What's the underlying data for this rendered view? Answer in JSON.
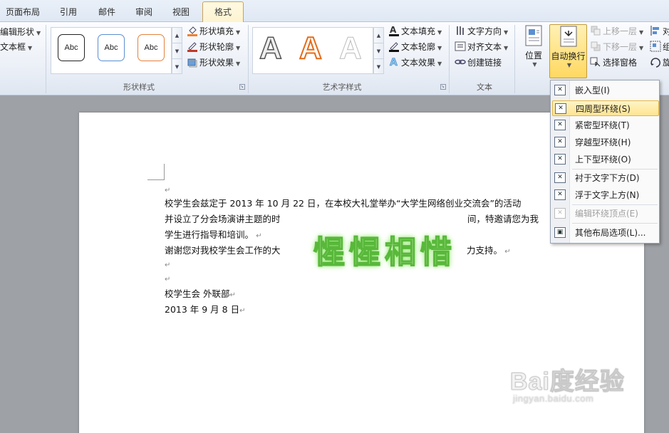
{
  "tabs": [
    {
      "label": "页面布局",
      "active": false
    },
    {
      "label": "引用",
      "active": false
    },
    {
      "label": "邮件",
      "active": false
    },
    {
      "label": "审阅",
      "active": false
    },
    {
      "label": "视图",
      "active": false
    },
    {
      "label": "格式",
      "active": true
    }
  ],
  "ribbon": {
    "insert_shapes": {
      "edit_shape": "编辑形状",
      "textbox": "文本框"
    },
    "shape_styles": {
      "label": "形状样式",
      "samples": [
        "Abc",
        "Abc",
        "Abc"
      ],
      "fill": "形状填充",
      "outline": "形状轮廓",
      "effects": "形状效果"
    },
    "wordart_styles": {
      "label": "艺术字样式",
      "samples": [
        "A",
        "A",
        "A"
      ],
      "text_fill": "文本填充",
      "text_outline": "文本轮廓",
      "text_effects": "文本效果"
    },
    "text": {
      "label": "文本",
      "direction": "文字方向",
      "align": "对齐文本",
      "link": "创建链接"
    },
    "arrange": {
      "position": "位置",
      "wrap": "自动换行",
      "bring_forward": "上移一层",
      "send_backward": "下移一层",
      "selection_pane": "选择窗格",
      "align_partial": "对",
      "group_partial": "组",
      "rotate_partial": "旋"
    }
  },
  "wrap_menu": {
    "items": [
      {
        "label": "嵌入型(I)",
        "hover": false,
        "disabled": false
      },
      {
        "label": "四周型环绕(S)",
        "hover": true,
        "disabled": false
      },
      {
        "label": "紧密型环绕(T)",
        "hover": false,
        "disabled": false
      },
      {
        "label": "穿越型环绕(H)",
        "hover": false,
        "disabled": false
      },
      {
        "label": "上下型环绕(O)",
        "hover": false,
        "disabled": false
      },
      {
        "label": "衬于文字下方(D)",
        "hover": false,
        "disabled": false
      },
      {
        "label": "浮于文字上方(N)",
        "hover": false,
        "disabled": false
      },
      {
        "label": "编辑环绕顶点(E)",
        "hover": false,
        "disabled": true
      },
      {
        "label": "其他布局选项(L)...",
        "hover": false,
        "disabled": false
      }
    ]
  },
  "document": {
    "line1": "校学生会兹定于 2013 年 10 月 22 日，在本校大礼堂举办“大学生网络创业交流会”的活动",
    "line2a": "并设立了分会场演讲主题的时",
    "line2b": "间，特邀请您为我",
    "line3": "学生进行指导和培训。",
    "line4a": "谢谢您对我校学生会工作的大",
    "line4b": "力支持。",
    "sign1": "校学生会 外联部",
    "sign2": "2013 年 9 月 8 日",
    "wordart": "惺惺相惜"
  },
  "watermark": {
    "line1": "Bai度经验",
    "line2": "jingyan.baidu.com"
  },
  "colors": {
    "accent_active_tab": "#fdf3d0",
    "wordart_glow": "#58b83a",
    "menu_hover": "#ffe490"
  }
}
